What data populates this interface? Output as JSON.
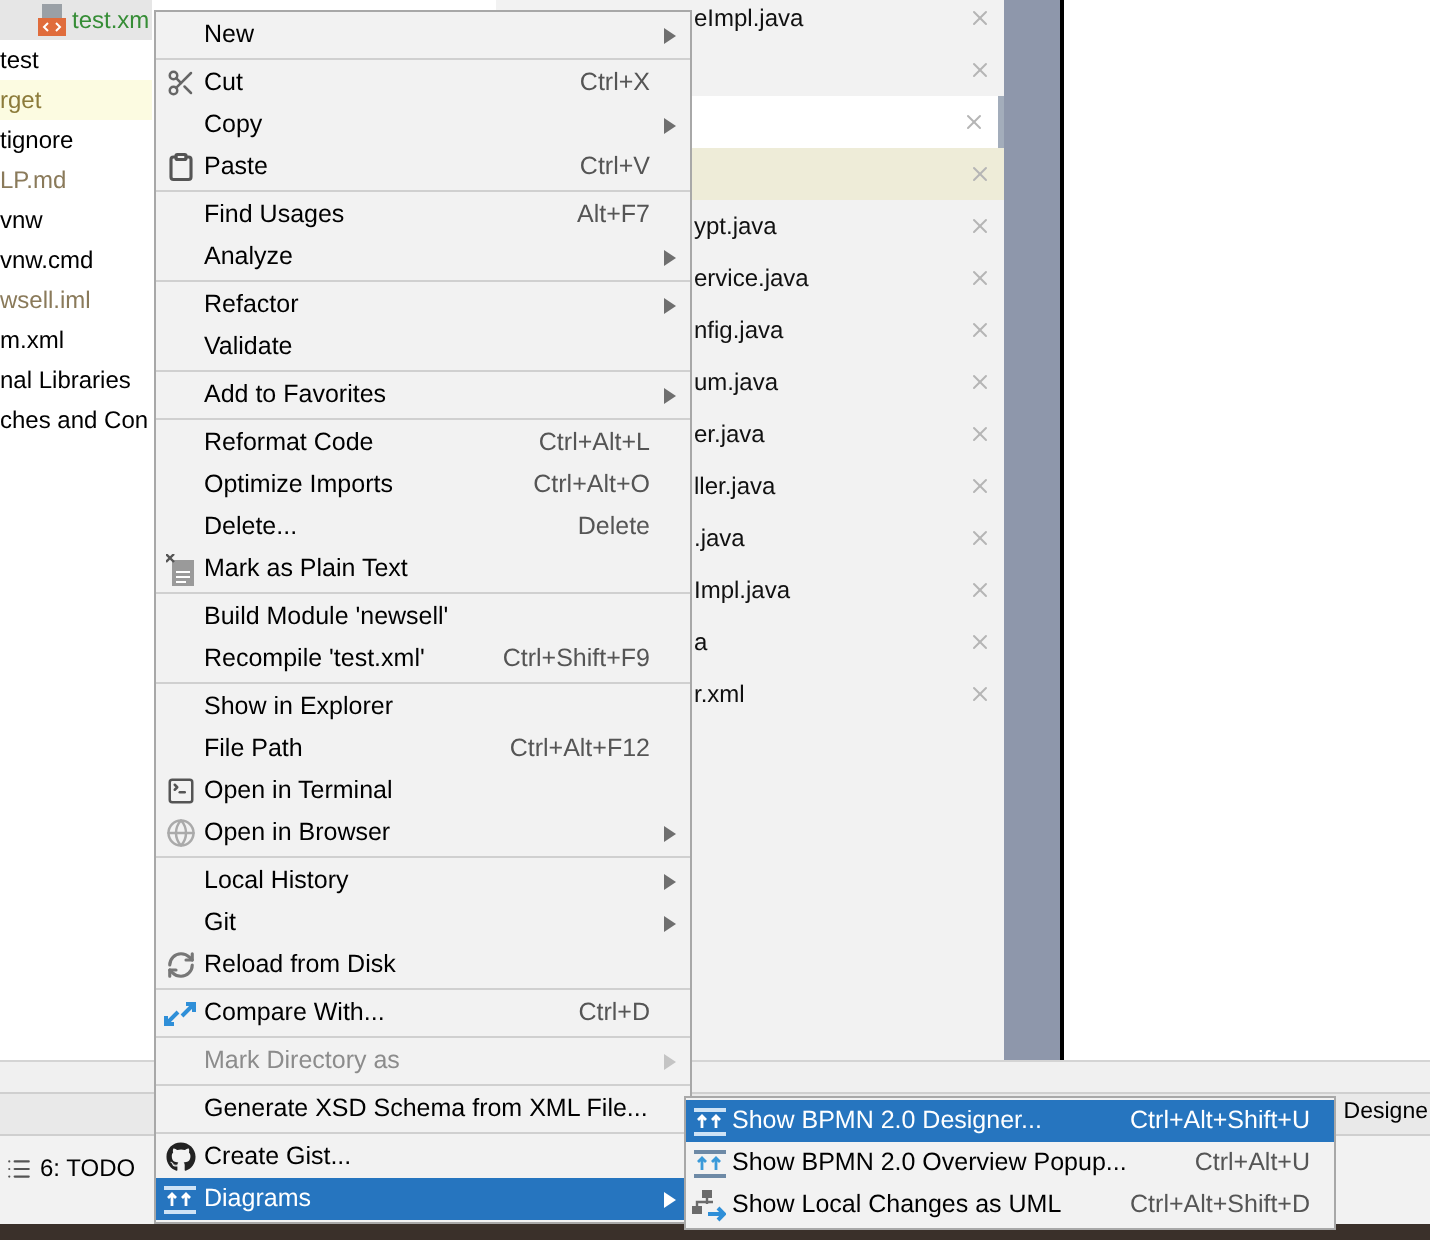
{
  "editor_tab": {
    "label": "test.xm",
    "color": "#368d36"
  },
  "project_tree": [
    {
      "label": "test",
      "highlighted": false,
      "color": "#000000"
    },
    {
      "label": "rget",
      "highlighted": true,
      "color": "#8c7b3a"
    },
    {
      "label": "tignore",
      "highlighted": false,
      "color": "#000000"
    },
    {
      "label": "LP.md",
      "highlighted": false,
      "color": "#8a7a5a"
    },
    {
      "label": "vnw",
      "highlighted": false,
      "color": "#000000"
    },
    {
      "label": "vnw.cmd",
      "highlighted": false,
      "color": "#000000"
    },
    {
      "label": "wsell.iml",
      "highlighted": false,
      "color": "#8a7a5a"
    },
    {
      "label": "m.xml",
      "highlighted": false,
      "color": "#000000"
    },
    {
      "label": "nal Libraries",
      "highlighted": false,
      "color": "#000000"
    },
    {
      "label": "ches and Con",
      "highlighted": false,
      "color": "#000000"
    }
  ],
  "open_files": [
    {
      "label": "eImpl.java",
      "selected": false,
      "highlighted": false
    },
    {
      "selected": false,
      "highlighted": false
    },
    {
      "selected": true,
      "highlighted": false
    },
    {
      "selected": false,
      "highlighted": true
    },
    {
      "label": "ypt.java",
      "selected": false,
      "highlighted": false
    },
    {
      "label": "ervice.java",
      "selected": false,
      "highlighted": false
    },
    {
      "label": "nfig.java",
      "selected": false,
      "highlighted": false
    },
    {
      "label": "um.java",
      "selected": false,
      "highlighted": false
    },
    {
      "label": "er.java",
      "selected": false,
      "highlighted": false
    },
    {
      "label": "ller.java",
      "selected": false,
      "highlighted": false
    },
    {
      "label": ".java",
      "selected": false,
      "highlighted": false
    },
    {
      "label": "Impl.java",
      "selected": false,
      "highlighted": false
    },
    {
      "label": "a",
      "selected": false,
      "highlighted": false
    },
    {
      "label": "r.xml",
      "selected": false,
      "highlighted": false
    }
  ],
  "status_tab": {
    "label": "Designe"
  },
  "tool_window_button": {
    "label": "6: TODO"
  },
  "context_menu": [
    [
      {
        "label": "New",
        "has_submenu": true,
        "disabled": false,
        "selected": false
      }
    ],
    [
      {
        "label": "Cut",
        "shortcut": "Ctrl+X",
        "has_submenu": false,
        "disabled": false,
        "selected": false
      },
      {
        "label": "Copy",
        "has_submenu": true,
        "disabled": false,
        "selected": false
      },
      {
        "label": "Paste",
        "shortcut": "Ctrl+V",
        "has_submenu": false,
        "disabled": false,
        "selected": false
      }
    ],
    [
      {
        "label": "Find Usages",
        "shortcut": "Alt+F7",
        "has_submenu": false,
        "disabled": false,
        "selected": false
      },
      {
        "label": "Analyze",
        "has_submenu": true,
        "disabled": false,
        "selected": false
      }
    ],
    [
      {
        "label": "Refactor",
        "has_submenu": true,
        "disabled": false,
        "selected": false
      },
      {
        "label": "Validate",
        "has_submenu": false,
        "disabled": false,
        "selected": false
      }
    ],
    [
      {
        "label": "Add to Favorites",
        "has_submenu": true,
        "disabled": false,
        "selected": false
      }
    ],
    [
      {
        "label": "Reformat Code",
        "shortcut": "Ctrl+Alt+L",
        "has_submenu": false,
        "disabled": false,
        "selected": false
      },
      {
        "label": "Optimize Imports",
        "shortcut": "Ctrl+Alt+O",
        "has_submenu": false,
        "disabled": false,
        "selected": false
      },
      {
        "label": "Delete...",
        "shortcut": "Delete",
        "has_submenu": false,
        "disabled": false,
        "selected": false
      },
      {
        "label": "Mark as Plain Text",
        "has_submenu": false,
        "disabled": false,
        "selected": false
      }
    ],
    [
      {
        "label": "Build Module 'newsell'",
        "has_submenu": false,
        "disabled": false,
        "selected": false
      },
      {
        "label": "Recompile 'test.xml'",
        "shortcut": "Ctrl+Shift+F9",
        "has_submenu": false,
        "disabled": false,
        "selected": false
      }
    ],
    [
      {
        "label": "Show in Explorer",
        "has_submenu": false,
        "disabled": false,
        "selected": false
      },
      {
        "label": "File Path",
        "shortcut": "Ctrl+Alt+F12",
        "has_submenu": false,
        "disabled": false,
        "selected": false
      },
      {
        "label": "Open in Terminal",
        "has_submenu": false,
        "disabled": false,
        "selected": false
      },
      {
        "label": "Open in Browser",
        "has_submenu": true,
        "disabled": false,
        "selected": false
      }
    ],
    [
      {
        "label": "Local History",
        "has_submenu": true,
        "disabled": false,
        "selected": false
      },
      {
        "label": "Git",
        "has_submenu": true,
        "disabled": false,
        "selected": false
      },
      {
        "label": "Reload from Disk",
        "has_submenu": false,
        "disabled": false,
        "selected": false
      }
    ],
    [
      {
        "label": "Compare With...",
        "shortcut": "Ctrl+D",
        "has_submenu": false,
        "disabled": false,
        "selected": false
      }
    ],
    [
      {
        "label": "Mark Directory as",
        "has_submenu": true,
        "disabled": true,
        "selected": false
      }
    ],
    [
      {
        "label": "Generate XSD Schema from XML File...",
        "has_submenu": false,
        "disabled": false,
        "selected": false
      }
    ],
    [
      {
        "label": "Create Gist...",
        "has_submenu": false,
        "disabled": false,
        "selected": false
      },
      {
        "label": "Diagrams",
        "has_submenu": true,
        "disabled": false,
        "selected": true
      }
    ]
  ],
  "diagrams_submenu": [
    {
      "label": "Show BPMN 2.0 Designer...",
      "shortcut": "Ctrl+Alt+Shift+U",
      "selected": true
    },
    {
      "label": "Show BPMN 2.0 Overview Popup...",
      "shortcut": "Ctrl+Alt+U",
      "selected": false
    },
    {
      "label": "Show Local Changes as UML",
      "shortcut": "Ctrl+Alt+Shift+D",
      "selected": false
    }
  ]
}
